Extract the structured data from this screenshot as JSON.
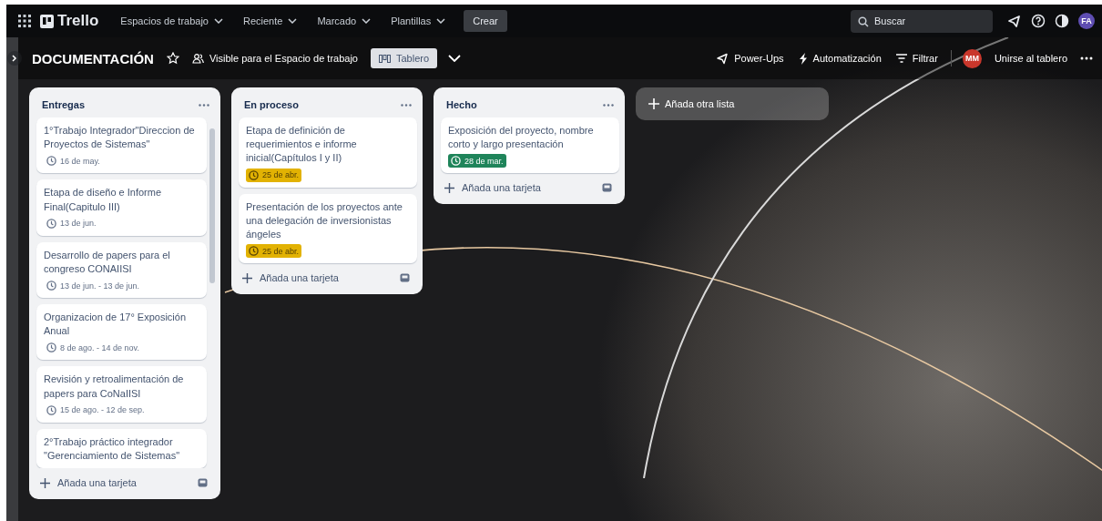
{
  "topbar": {
    "logo": "Trello",
    "menus": [
      {
        "label": "Espacios de trabajo"
      },
      {
        "label": "Reciente"
      },
      {
        "label": "Marcado"
      },
      {
        "label": "Plantillas"
      }
    ],
    "create": "Crear",
    "search": {
      "placeholder": "Buscar"
    },
    "avatar": "FA"
  },
  "board_header": {
    "title": "DOCUMENTACIÓN",
    "starred": false,
    "visibility": "Visible para el Espacio de trabajo",
    "view": "Tablero",
    "power_ups": "Power-Ups",
    "automation": "Automatización",
    "filter": "Filtrar",
    "member": "MM",
    "join": "Unirse al tablero"
  },
  "lists": [
    {
      "title": "Entregas",
      "scrollbar": true,
      "cards": [
        {
          "title": "1°Trabajo Integrador\"Direccion de Proyectos de Sistemas\"",
          "date": "16 de may."
        },
        {
          "title": "Etapa de diseño e Informe Final(Capitulo III)",
          "date": "13 de jun."
        },
        {
          "title": "Desarrollo de papers para el congreso CONAIISI",
          "date": "13 de jun. - 13 de jun."
        },
        {
          "title": "Organizacion de 17° Exposición Anual",
          "date": "8 de ago. - 14 de nov."
        },
        {
          "title": "Revisión y retroalimentación de papers para CoNaIISI",
          "date": "15 de ago. - 12 de sep."
        },
        {
          "title": "2°Trabajo práctico integrador \"Gerenciamiento de Sistemas\""
        }
      ],
      "add": "Añada una tarjeta"
    },
    {
      "title": "En proceso",
      "scrollbar": false,
      "cards": [
        {
          "title": "Etapa de definición de requerimientos e informe inicial(Capítulos I y II)",
          "date": "25 de abr.",
          "color": "#e2b203"
        },
        {
          "title": "Presentación de los proyectos ante una delegación de inversionistas ángeles",
          "date": "25 de abr.",
          "color": "#e2b203"
        }
      ],
      "add": "Añada una tarjeta"
    },
    {
      "title": "Hecho",
      "scrollbar": false,
      "cards": [
        {
          "title": "Exposición del proyecto, nombre corto y largo presentación",
          "date": "28 de mar.",
          "color": "#1f845a"
        }
      ],
      "add": "Añada una tarjeta"
    }
  ],
  "add_list": "Añada otra lista"
}
